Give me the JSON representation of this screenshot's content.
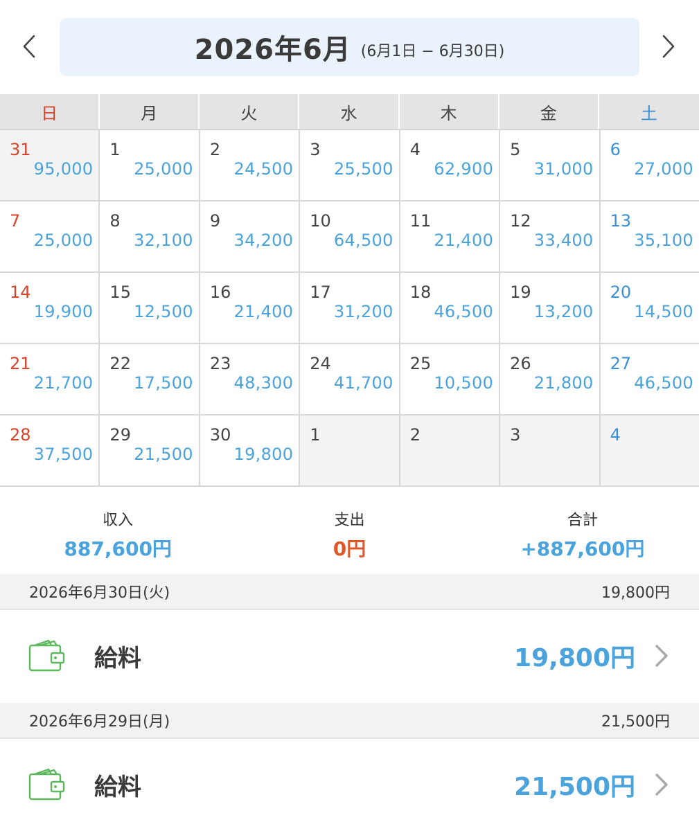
{
  "header": {
    "title": "2026年6月",
    "range": "(6月1日 − 6月30日)"
  },
  "weekdays": [
    "日",
    "月",
    "火",
    "水",
    "木",
    "金",
    "土"
  ],
  "calendar": {
    "cells": [
      {
        "day": "31",
        "amount": "95,000",
        "other": true
      },
      {
        "day": "1",
        "amount": "25,000"
      },
      {
        "day": "2",
        "amount": "24,500"
      },
      {
        "day": "3",
        "amount": "25,500"
      },
      {
        "day": "4",
        "amount": "62,900"
      },
      {
        "day": "5",
        "amount": "31,000"
      },
      {
        "day": "6",
        "amount": "27,000"
      },
      {
        "day": "7",
        "amount": "25,000"
      },
      {
        "day": "8",
        "amount": "32,100"
      },
      {
        "day": "9",
        "amount": "34,200"
      },
      {
        "day": "10",
        "amount": "64,500"
      },
      {
        "day": "11",
        "amount": "21,400"
      },
      {
        "day": "12",
        "amount": "33,400"
      },
      {
        "day": "13",
        "amount": "35,100"
      },
      {
        "day": "14",
        "amount": "19,900"
      },
      {
        "day": "15",
        "amount": "12,500"
      },
      {
        "day": "16",
        "amount": "21,400"
      },
      {
        "day": "17",
        "amount": "31,200"
      },
      {
        "day": "18",
        "amount": "46,500"
      },
      {
        "day": "19",
        "amount": "13,200"
      },
      {
        "day": "20",
        "amount": "14,500"
      },
      {
        "day": "21",
        "amount": "21,700"
      },
      {
        "day": "22",
        "amount": "17,500"
      },
      {
        "day": "23",
        "amount": "48,300"
      },
      {
        "day": "24",
        "amount": "41,700"
      },
      {
        "day": "25",
        "amount": "10,500"
      },
      {
        "day": "26",
        "amount": "21,800"
      },
      {
        "day": "27",
        "amount": "46,500"
      },
      {
        "day": "28",
        "amount": "37,500"
      },
      {
        "day": "29",
        "amount": "21,500"
      },
      {
        "day": "30",
        "amount": "19,800"
      },
      {
        "day": "1",
        "amount": "",
        "other": true
      },
      {
        "day": "2",
        "amount": "",
        "other": true
      },
      {
        "day": "3",
        "amount": "",
        "other": true
      },
      {
        "day": "4",
        "amount": "",
        "other": true
      }
    ]
  },
  "summary": {
    "income_label": "収入",
    "income_value": "887,600円",
    "expense_label": "支出",
    "expense_value": "0円",
    "total_label": "合計",
    "total_value": "+887,600円"
  },
  "days": [
    {
      "date": "2026年6月30日(火)",
      "day_total": "19,800円",
      "entry_label": "給料",
      "entry_amount": "19,800円"
    },
    {
      "date": "2026年6月29日(月)",
      "day_total": "21,500円",
      "entry_label": "給料",
      "entry_amount": "21,500円"
    }
  ],
  "colors": {
    "income": "#4aa3dc",
    "expense": "#e0582a",
    "sunday": "#d6432b",
    "saturday": "#3a8fd6",
    "wallet_icon": "#5cb85c"
  },
  "icons": {
    "prev": "chevron-left-icon",
    "next": "chevron-right-icon",
    "category": "wallet-icon",
    "row_arrow": "chevron-right-icon"
  }
}
